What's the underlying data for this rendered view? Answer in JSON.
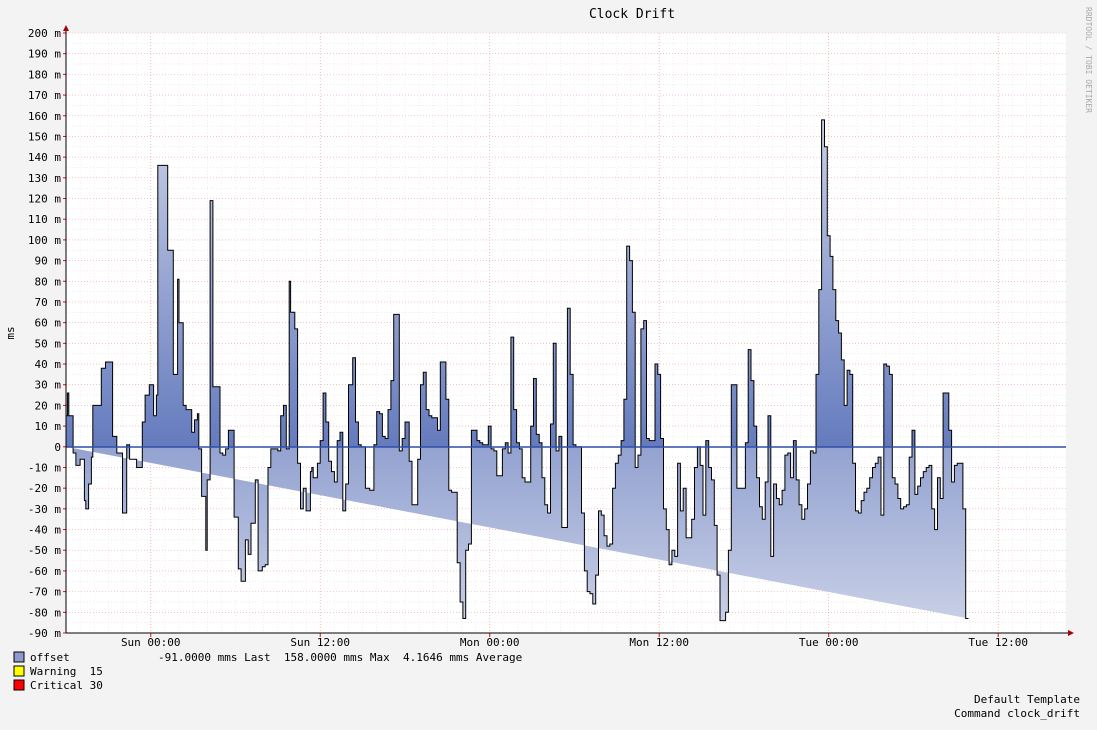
{
  "chart_data": {
    "type": "area",
    "title": "Clock Drift",
    "ylabel": "ms",
    "ylim": [
      -90,
      200
    ],
    "y_ticks": [
      "200 m",
      "190 m",
      "180 m",
      "170 m",
      "160 m",
      "150 m",
      "140 m",
      "130 m",
      "120 m",
      "110 m",
      "100 m",
      "90 m",
      "80 m",
      "70 m",
      "60 m",
      "50 m",
      "40 m",
      "30 m",
      "20 m",
      "10 m",
      "0",
      "-10 m",
      "-20 m",
      "-30 m",
      "-40 m",
      "-50 m",
      "-60 m",
      "-70 m",
      "-80 m",
      "-90 m"
    ],
    "x_ticks": [
      "Sun 00:00",
      "Sun 12:00",
      "Mon 00:00",
      "Mon 12:00",
      "Tue 00:00",
      "Tue 12:00"
    ],
    "x_tick_hours": [
      6,
      18,
      30,
      42,
      54,
      66
    ],
    "x_range_hours": [
      0,
      70.8
    ],
    "grid": true,
    "watermark": "RRDTOOL / TOBI OETIKER",
    "series": [
      {
        "name": "offset",
        "color": "#3f5fb3",
        "x_hours": [
          0.0,
          0.1,
          0.2,
          0.5,
          0.7,
          1.0,
          1.3,
          1.4,
          1.6,
          1.8,
          1.9,
          2.3,
          2.5,
          2.8,
          3.3,
          3.5,
          3.6,
          3.8,
          4.0,
          4.1,
          4.3,
          4.5,
          5.0,
          5.4,
          5.6,
          5.9,
          6.1,
          6.2,
          6.4,
          6.5,
          6.8,
          7.2,
          7.6,
          7.9,
          8.0,
          8.3,
          8.5,
          8.9,
          9.1,
          9.3,
          9.4,
          9.6,
          9.7,
          9.9,
          10.0,
          10.2,
          10.4,
          10.7,
          10.9,
          11.1,
          11.3,
          11.5,
          11.7,
          11.9,
          12.2,
          12.4,
          12.7,
          12.9,
          13.1,
          13.4,
          13.6,
          13.9,
          14.1,
          14.3,
          14.5,
          14.7,
          15.0,
          15.2,
          15.4,
          15.6,
          15.8,
          15.9,
          16.0,
          16.2,
          16.4,
          16.6,
          16.8,
          17.0,
          17.3,
          17.4,
          17.5,
          17.7,
          17.8,
          18.0,
          18.2,
          18.4,
          18.6,
          18.8,
          19.0,
          19.2,
          19.4,
          19.6,
          19.8,
          20.0,
          20.3,
          20.5,
          20.7,
          20.9,
          21.2,
          21.5,
          21.8,
          22.0,
          22.2,
          22.4,
          22.6,
          22.8,
          23.0,
          23.2,
          23.4,
          23.6,
          23.8,
          24.0,
          24.3,
          24.5,
          24.7,
          24.9,
          25.1,
          25.3,
          25.5,
          25.7,
          25.9,
          26.1,
          26.3,
          26.5,
          26.7,
          26.9,
          27.1,
          27.3,
          27.5,
          27.7,
          27.9,
          28.1,
          28.3,
          28.5,
          28.7,
          28.9,
          29.1,
          29.3,
          29.5,
          29.7,
          29.9,
          30.1,
          30.3,
          30.5,
          30.7,
          30.9,
          31.1,
          31.3,
          31.5,
          31.7,
          31.9,
          32.1,
          32.3,
          32.5,
          32.7,
          32.9,
          33.1,
          33.3,
          33.5,
          33.7,
          33.9,
          34.1,
          34.3,
          34.5,
          34.7,
          34.9,
          35.1,
          35.3,
          35.5,
          35.7,
          35.9,
          36.1,
          36.3,
          36.5,
          36.7,
          36.9,
          37.1,
          37.3,
          37.5,
          37.7,
          37.9,
          38.1,
          38.3,
          38.5,
          38.7,
          38.9,
          39.1,
          39.3,
          39.5,
          39.7,
          39.9,
          40.1,
          40.3,
          40.5,
          40.7,
          40.9,
          41.1,
          41.3,
          41.5,
          41.7,
          41.9,
          42.1,
          42.3,
          42.5,
          42.7,
          42.9,
          43.1,
          43.3,
          43.5,
          43.7,
          43.9,
          44.1,
          44.3,
          44.5,
          44.7,
          44.9,
          45.1,
          45.3,
          45.5,
          45.7,
          45.9,
          46.1,
          46.3,
          46.5,
          46.7,
          46.9,
          47.1,
          47.3,
          47.5,
          47.7,
          47.9,
          48.1,
          48.3,
          48.5,
          48.7,
          48.9,
          49.1,
          49.3,
          49.5,
          49.7,
          49.9,
          50.1,
          50.3,
          50.5,
          50.7,
          50.9,
          51.1,
          51.3,
          51.5,
          51.7,
          51.9,
          52.1,
          52.3,
          52.5,
          52.7,
          52.9,
          53.1,
          53.3,
          53.5,
          53.7,
          53.9,
          54.1,
          54.3,
          54.5,
          54.7,
          54.9,
          55.1,
          55.3,
          55.5,
          55.7,
          55.9,
          56.1,
          56.3,
          56.5,
          56.7,
          56.9,
          57.1,
          57.3,
          57.5,
          57.7,
          57.9,
          58.1,
          58.3,
          58.5,
          58.7,
          58.9,
          59.1,
          59.3,
          59.5,
          59.7,
          59.9,
          60.1,
          60.3,
          60.5,
          60.7,
          60.9,
          61.1,
          61.3,
          61.5,
          61.7,
          61.9,
          62.1,
          62.3,
          62.5,
          62.7,
          62.9,
          63.1,
          63.3,
          63.5,
          63.7,
          63.9,
          64.1,
          64.3,
          64.5,
          64.7,
          64.9,
          65.1,
          65.3,
          65.5,
          65.7,
          65.9,
          66.1,
          66.3,
          66.5,
          66.7,
          66.9,
          67.1,
          67.3,
          67.5,
          67.7,
          67.9,
          68.1,
          68.3,
          68.5,
          68.7,
          68.9,
          69.1,
          69.3,
          69.5,
          69.7,
          69.9,
          70.1,
          70.3,
          70.5,
          70.7
        ],
        "values": [
          15,
          26,
          15,
          -3,
          -9,
          -6,
          -26,
          -30,
          -18,
          -5,
          20,
          20,
          38,
          41,
          5,
          5,
          -3,
          -3,
          -32,
          -32,
          1,
          -6,
          -10,
          12,
          25,
          30,
          30,
          15,
          25,
          136,
          136,
          95,
          35,
          81,
          60,
          20,
          18,
          7,
          13,
          16,
          -1,
          -24,
          -24,
          -50,
          -16,
          119,
          29,
          29,
          -3,
          -4,
          -1,
          8,
          8,
          -34,
          -59,
          -65,
          -45,
          -52,
          -37,
          -16,
          -60,
          -58,
          -57,
          -10,
          -1,
          -1,
          -2,
          15,
          20,
          -1,
          80,
          65,
          65,
          57,
          -8,
          -30,
          -20,
          -31,
          -12,
          -10,
          -15,
          -15,
          -8,
          3,
          26,
          12,
          -7,
          -12,
          -17,
          3,
          7,
          -31,
          -18,
          30,
          43,
          12,
          1,
          0,
          -20,
          -21,
          1,
          17,
          16,
          5,
          4,
          18,
          32,
          64,
          64,
          -2,
          4,
          12,
          -7,
          -28,
          -28,
          -6,
          30,
          36,
          18,
          15,
          14,
          14,
          8,
          41,
          41,
          23,
          -21,
          -22,
          -22,
          -56,
          -75,
          -83,
          -50,
          -47,
          8,
          8,
          3,
          2,
          1,
          1,
          10,
          -1,
          -2,
          -14,
          -14,
          -1,
          2,
          -3,
          53,
          18,
          2,
          -1,
          -15,
          -17,
          -17,
          10,
          33,
          6,
          2,
          -15,
          -28,
          -32,
          11,
          50,
          -2,
          5,
          -39,
          -39,
          67,
          35,
          1,
          0,
          0,
          -32,
          -60,
          -70,
          -71,
          -76,
          -62,
          -31,
          -33,
          -43,
          -48,
          -47,
          -20,
          -8,
          -4,
          3,
          23,
          97,
          90,
          65,
          -10,
          -4,
          57,
          61,
          4,
          3,
          3,
          40,
          35,
          4,
          -30,
          -40,
          -57,
          -50,
          -53,
          -8,
          -31,
          -20,
          -44,
          -44,
          -35,
          -10,
          0,
          -9,
          -33,
          3,
          -10,
          -16,
          -38,
          -62,
          -84,
          -84,
          -80,
          -50,
          30,
          30,
          -20,
          -20,
          -20,
          2,
          47,
          32,
          10,
          -15,
          -29,
          -35,
          -17,
          15,
          -53,
          -18,
          -25,
          -28,
          -21,
          -4,
          -3,
          -15,
          3,
          -16,
          -28,
          -35,
          -30,
          -18,
          -2,
          -3,
          35,
          76,
          158,
          145,
          102,
          92,
          76,
          61,
          55,
          42,
          20,
          37,
          35,
          -8,
          -31,
          -32,
          -26,
          -22,
          -20,
          -15,
          -10,
          -8,
          -5,
          -33,
          40,
          39,
          35,
          -15,
          -18,
          -25,
          -30,
          -29,
          -28,
          -5,
          8,
          -23,
          -19,
          -15,
          -12,
          -10,
          -9,
          -30,
          -40,
          -15,
          -25,
          26,
          26,
          8,
          -17,
          -9,
          -8,
          -8,
          -30,
          -83
        ]
      }
    ],
    "legend": [
      {
        "label": "offset",
        "color": "#8e99cc",
        "stats": "-91.0000 mms Last  158.0000 mms Max  4.1646 mms Average"
      },
      {
        "label": "Warning  15",
        "color": "#ffff00"
      },
      {
        "label": "Critical 30",
        "color": "#ff0000"
      }
    ],
    "footer": [
      "Default Template",
      "Command clock_drift"
    ]
  }
}
